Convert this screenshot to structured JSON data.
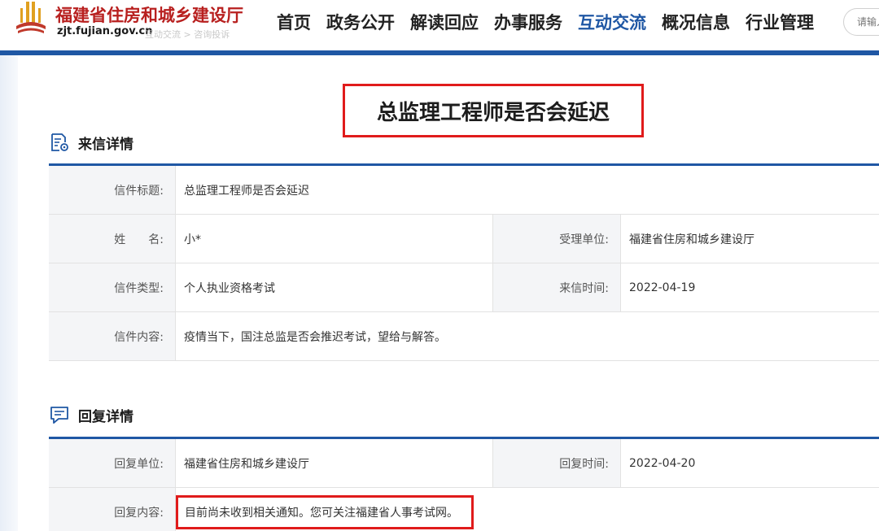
{
  "header": {
    "site_name": "福建省住房和城乡建设厅",
    "site_url": "zjt.fujian.gov.cn",
    "breadcrumb_ghost": "互动交流 > 咨询投诉",
    "nav": [
      "首页",
      "政务公开",
      "解读回应",
      "办事服务",
      "互动交流",
      "概况信息",
      "行业管理"
    ],
    "active_nav": "互动交流",
    "search_placeholder": "请输入",
    "brand_color": "#b8201f",
    "accent_color": "#1f57a4"
  },
  "page": {
    "title": "总监理工程师是否会延迟"
  },
  "letter": {
    "section_title": "来信详情",
    "section_icon": "document-view-icon",
    "title_label": "信件标题:",
    "title_value": "总监理工程师是否会延迟",
    "name_label": "姓　　名:",
    "name_value": "小*",
    "dept_label": "受理单位:",
    "dept_value": "福建省住房和城乡建设厅",
    "type_label": "信件类型:",
    "type_value": "个人执业资格考试",
    "time_label": "来信时间:",
    "time_value": "2022-04-19",
    "content_label": "信件内容:",
    "content_value": "疫情当下，国注总监是否会推迟考试，望给与解答。"
  },
  "reply": {
    "section_title": "回复详情",
    "section_icon": "chat-bubble-icon",
    "dept_label": "回复单位:",
    "dept_value": "福建省住房和城乡建设厅",
    "time_label": "回复时间:",
    "time_value": "2022-04-20",
    "content_label": "回复内容:",
    "content_value": "目前尚未收到相关通知。您可关注福建省人事考试网。"
  },
  "highlight_color": "#e01b1b"
}
